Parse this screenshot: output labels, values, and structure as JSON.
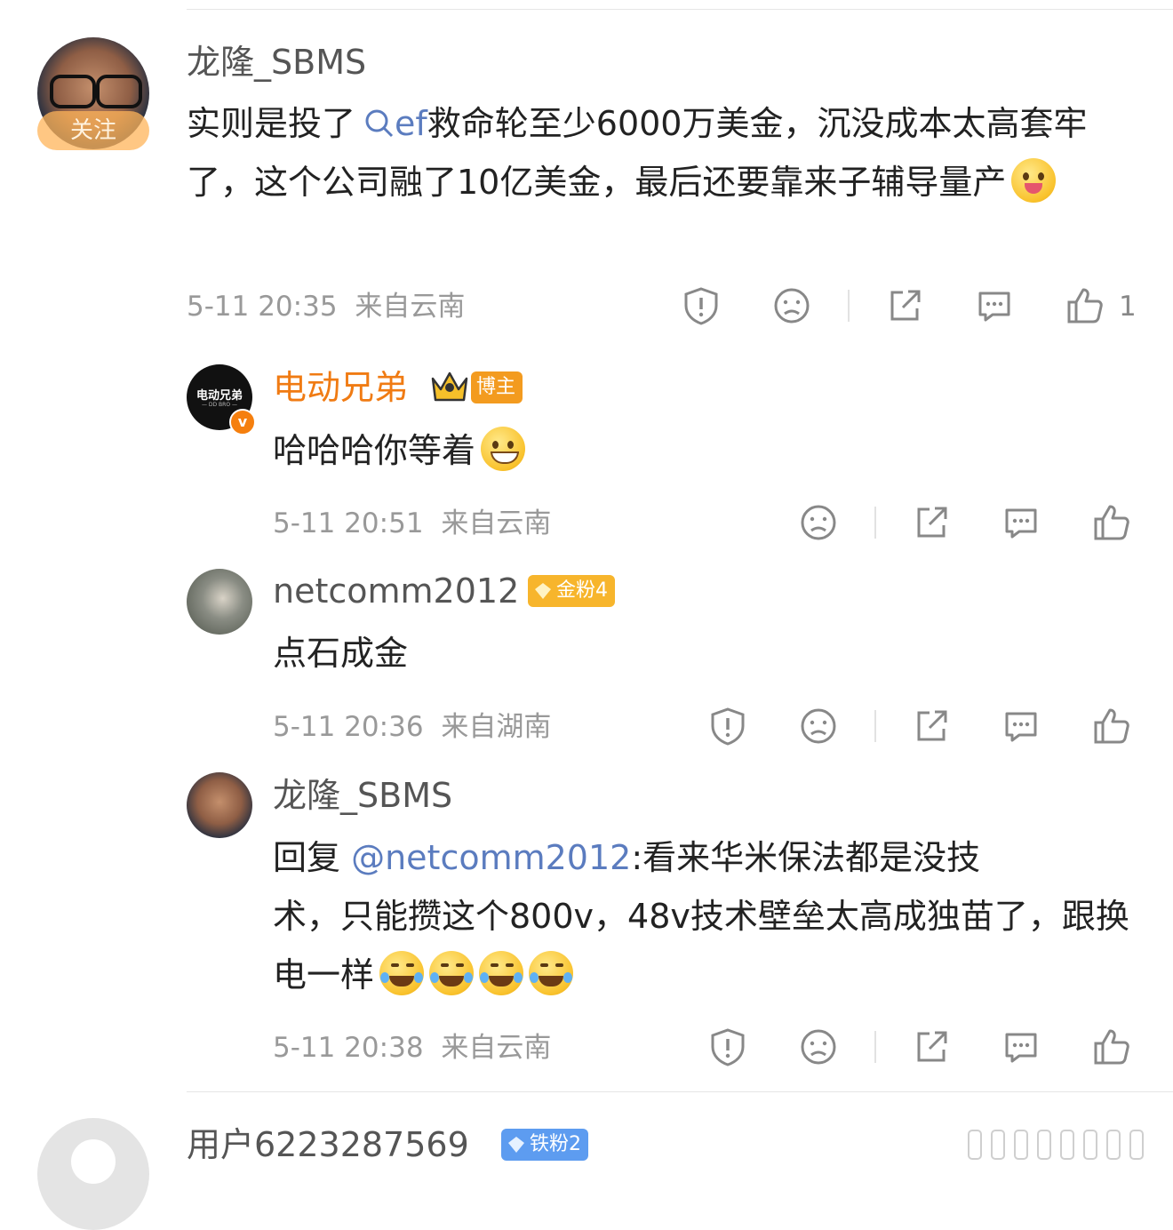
{
  "colors": {
    "accent_orange": "#f07b13",
    "link_blue": "#5b7cbf",
    "meta_gray": "#999999"
  },
  "comment_main": {
    "username": "龙隆_SBMS",
    "follow_label": "关注",
    "text_before_link": "实则是投了",
    "search_link": "ef",
    "text_after_link": "救命轮至少6000万美金，沉没成本太高套牢了，这个公司融了10亿美金，最后还要靠来子辅导量产",
    "emoji": "tongue-face-emoji",
    "timestamp": "5-11 20:35",
    "location": "来自云南",
    "like_count": "1"
  },
  "replies": [
    {
      "username": "电动兄弟",
      "avatar_text": "电动兄弟",
      "avatar_subtext": "— DD BRO —",
      "badge_label": "博主",
      "text": "哈哈哈你等着",
      "emoji": "grin-emoji",
      "timestamp": "5-11 20:51",
      "location": "来自云南"
    },
    {
      "username": "netcomm2012",
      "badge_label": "金粉4",
      "text": "点石成金",
      "timestamp": "5-11 20:36",
      "location": "来自湖南"
    },
    {
      "username": "龙隆_SBMS",
      "reply_prefix": "回复 ",
      "mention": "@netcomm2012",
      "text_line1": ":看来华米保法都是没技",
      "text_rest": "术，只能攒这个800v，48v技术壁垒太高成独苗了，跟换电一样",
      "emoji": "laughing-tears-emoji",
      "timestamp": "5-11 20:38",
      "location": "来自云南"
    }
  ],
  "next_comment": {
    "username": "用户6223287569",
    "badge_label": "铁粉2"
  }
}
